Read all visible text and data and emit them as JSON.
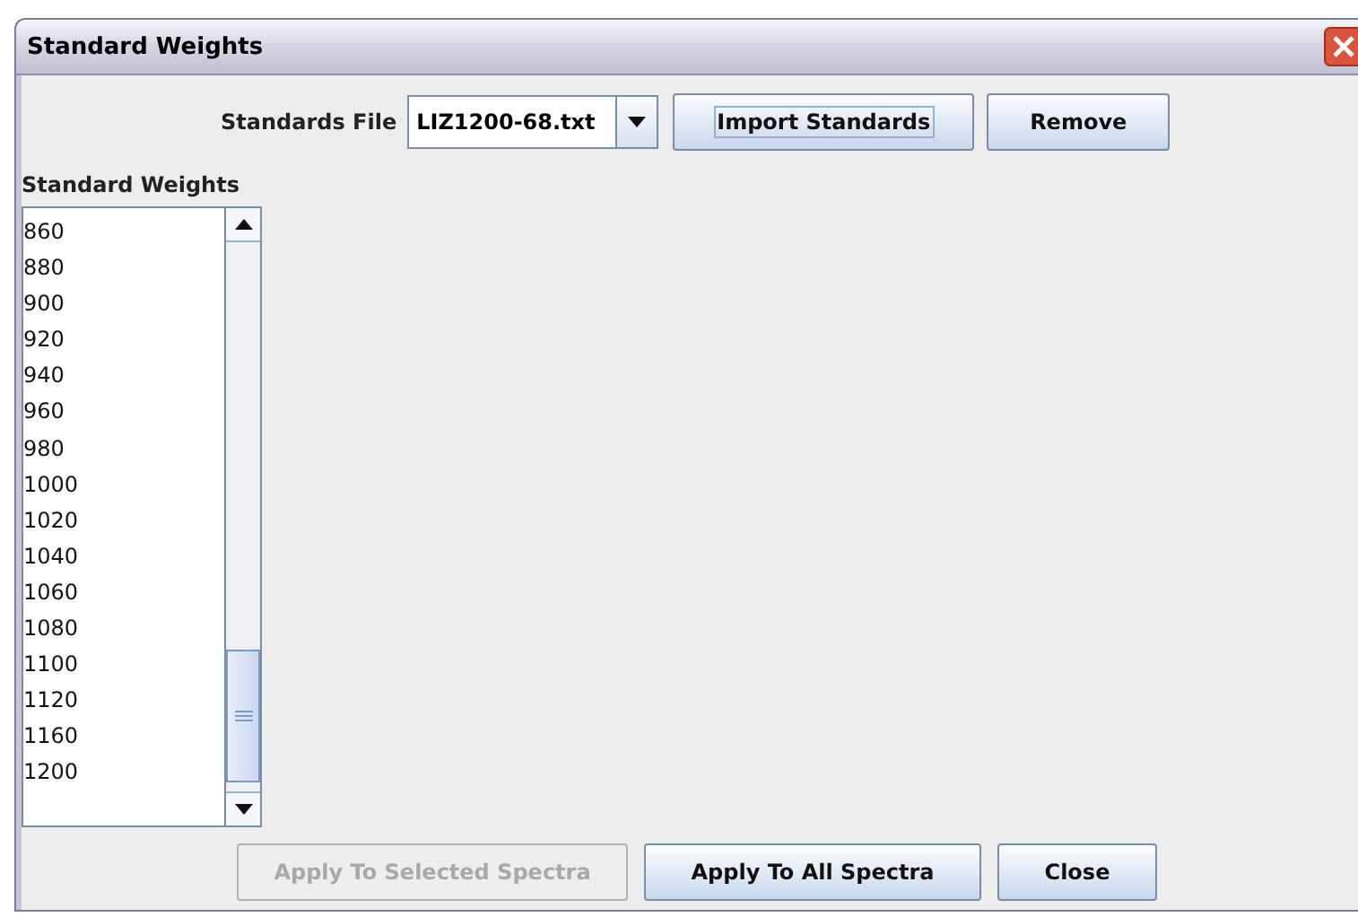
{
  "window": {
    "title": "Standard Weights"
  },
  "standards_file": {
    "label": "Standards File",
    "value": "LIZ1200-68.txt"
  },
  "toolbar_buttons": [
    {
      "label": "Import Standards",
      "disabled": false,
      "focused": true
    },
    {
      "label": "Remove",
      "disabled": false,
      "focused": false
    }
  ],
  "weights_list": {
    "label": "Standard Weights",
    "items": [
      "860",
      "880",
      "900",
      "920",
      "940",
      "960",
      "980",
      "1000",
      "1020",
      "1040",
      "1060",
      "1080",
      "1100",
      "1120",
      "1160",
      "1200"
    ]
  },
  "buttons": [
    {
      "label": "Apply To Selected Spectra",
      "disabled": true,
      "focused": false
    },
    {
      "label": "Apply To All Spectra",
      "disabled": false,
      "focused": false
    },
    {
      "label": "Close",
      "disabled": false,
      "focused": false
    }
  ]
}
